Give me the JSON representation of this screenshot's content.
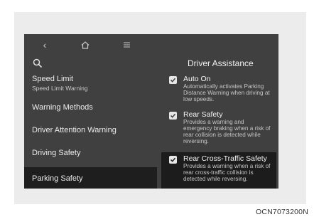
{
  "nav": {
    "back_icon": "back-chevron-icon",
    "home_icon": "home-icon",
    "menu_icon": "menu-icon",
    "search_icon": "search-icon"
  },
  "menu": {
    "speed_limit": {
      "label": "Speed Limit",
      "sub": "Speed Limit Warning"
    },
    "warning_methods": "Warning Methods",
    "driver_attention_warning": "Driver Attention Warning",
    "driving_safety": "Driving Safety",
    "parking_safety": "Parking Safety"
  },
  "panel": {
    "title": "Driver Assistance",
    "options": {
      "auto_on": {
        "title": "Auto On",
        "desc": "Automatically activates Parking Distance Warning when driving at low speeds.",
        "checked": true
      },
      "rear_safety": {
        "title": "Rear Safety",
        "desc": "Provides a warning and emergency braking when a risk of rear collision is detected while reversing.",
        "checked": true
      },
      "rcts": {
        "title": "Rear Cross-Traffic Safety",
        "desc": "Provides a warning when a risk of rear cross-traffic collision is detected while reversing.",
        "checked": true
      }
    }
  },
  "figure_code": "OCN7073200N",
  "colors": {
    "screen_bg": "#404040",
    "selected_bg": "#1e1e1e",
    "text": "#ebebeb"
  }
}
